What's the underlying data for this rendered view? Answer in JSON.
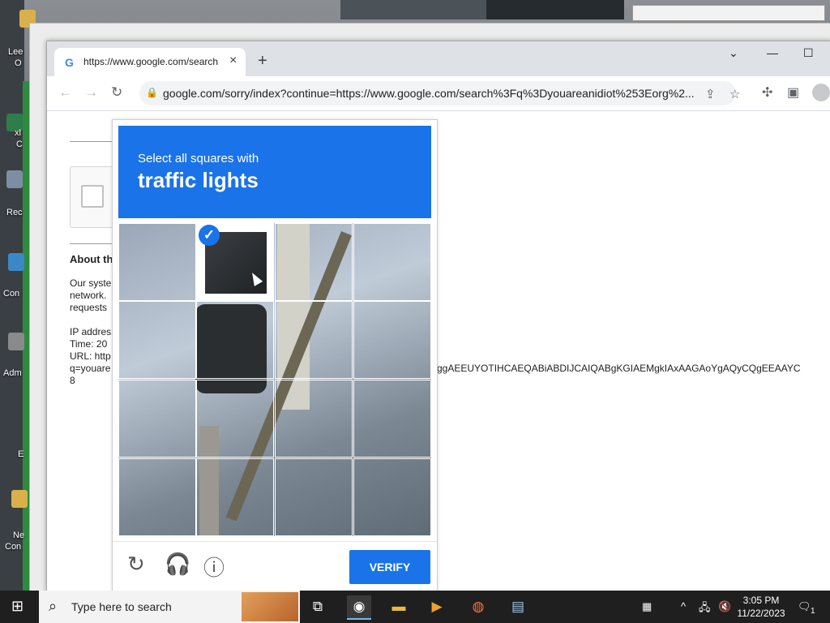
{
  "desktop": {
    "labels": [
      "Lee",
      "O",
      "xl",
      "C",
      "Rec",
      "Con",
      "Adm",
      "E",
      "Ne",
      "Con"
    ]
  },
  "browser": {
    "tab_title": "https://www.google.com/search",
    "url": "google.com/sorry/index?continue=https://www.google.com/search%3Fq%3Dyouareanidiot%253Eorg%2..."
  },
  "page": {
    "about_heading": "About th",
    "body_lines": [
      "Our syste",
      "network.",
      "requests"
    ],
    "ip_line": "IP addres",
    "time_line": "Time: 20",
    "url_line": "URL: http",
    "q_line": "q=youare",
    "url_tail": "ggAEEUYOTIHCAEQABiABDIJCAIQABgKGIAEMgkIAxAAGAoYgAQyCQgEEAAYC",
    "line_8": "8"
  },
  "captcha": {
    "prompt": "Select all squares with",
    "target": "traffic lights",
    "grid": {
      "rows": 4,
      "cols": 4,
      "selected": [
        [
          0,
          1
        ]
      ]
    },
    "verify_label": "VERIFY"
  },
  "taskbar": {
    "search_placeholder": "Type here to search",
    "time": "3:05 PM",
    "date": "11/22/2023",
    "notifications": "1"
  }
}
